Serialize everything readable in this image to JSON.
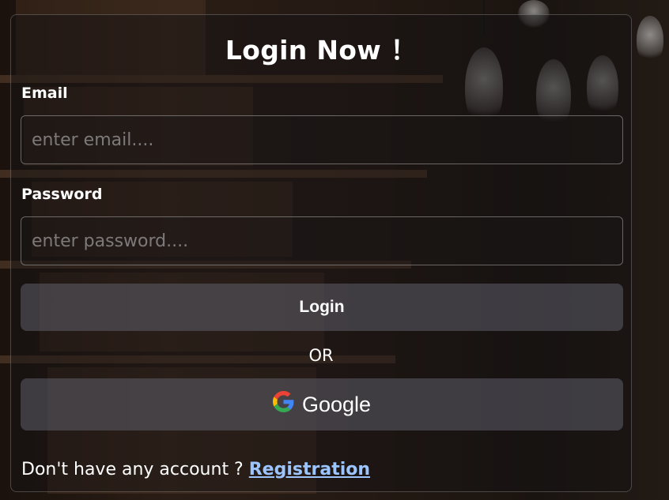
{
  "form": {
    "title": "Login Now ！",
    "email": {
      "label": "Email",
      "value": "",
      "placeholder": "enter email...."
    },
    "password": {
      "label": "Password",
      "value": "",
      "placeholder": "enter password...."
    },
    "login_button": "Login",
    "separator": "OR",
    "google_button": "Google",
    "footer": {
      "text": "Don't have any account ? ",
      "link": "Registration"
    }
  },
  "icons": {
    "google": "google-g-logo"
  },
  "colors": {
    "link": "#9cc4ff",
    "button_bg": "#5f5f69",
    "text": "#ffffff"
  }
}
